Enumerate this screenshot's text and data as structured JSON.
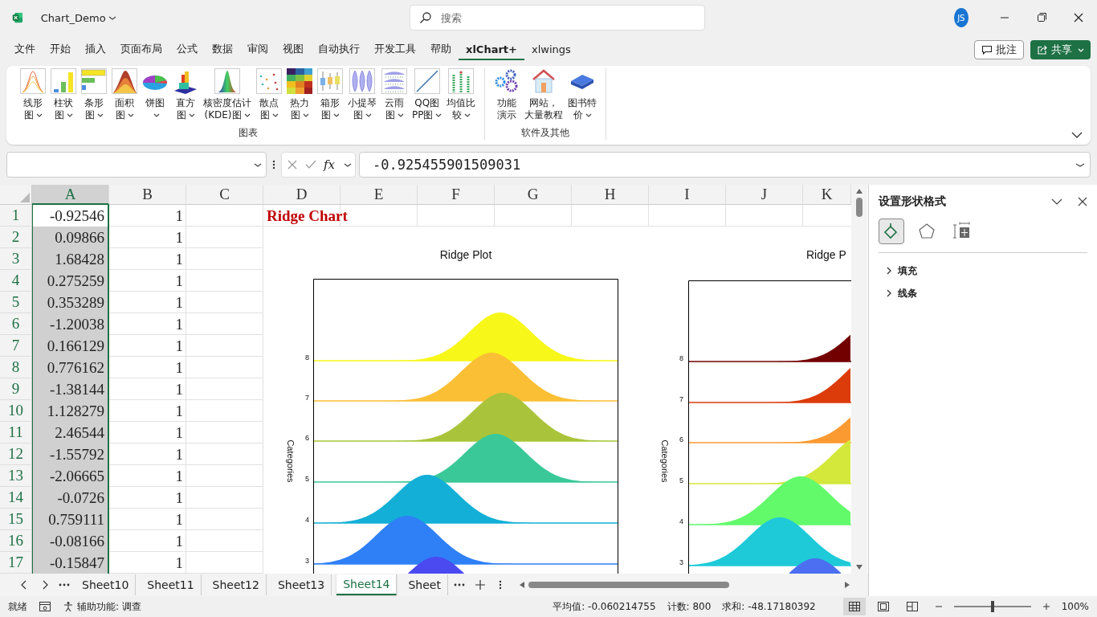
{
  "title_bar": {
    "file_name": "Chart_Demo",
    "search_placeholder": "搜索",
    "user_initials": "JS"
  },
  "menu_tabs": [
    {
      "label": "文件",
      "selected": false
    },
    {
      "label": "开始",
      "selected": false
    },
    {
      "label": "插入",
      "selected": false
    },
    {
      "label": "页面布局",
      "selected": false
    },
    {
      "label": "公式",
      "selected": false
    },
    {
      "label": "数据",
      "selected": false
    },
    {
      "label": "审阅",
      "selected": false
    },
    {
      "label": "视图",
      "selected": false
    },
    {
      "label": "自动执行",
      "selected": false
    },
    {
      "label": "开发工具",
      "selected": false
    },
    {
      "label": "帮助",
      "selected": false
    },
    {
      "label": "xlChart+",
      "selected": true
    },
    {
      "label": "xlwings",
      "selected": false
    }
  ],
  "header_buttons": {
    "comments": "批注",
    "share": "共享"
  },
  "ribbon": {
    "groups": [
      {
        "label": "图表",
        "items": [
          {
            "lines": [
              "线形",
              "图"
            ],
            "dropdown": true
          },
          {
            "lines": [
              "柱状",
              "图"
            ],
            "dropdown": true
          },
          {
            "lines": [
              "条形",
              "图"
            ],
            "dropdown": true
          },
          {
            "lines": [
              "面积",
              "图"
            ],
            "dropdown": true
          },
          {
            "lines": [
              "饼图"
            ],
            "dropdown": true
          },
          {
            "lines": [
              "直方",
              "图"
            ],
            "dropdown": true
          },
          {
            "lines": [
              "核密度估计",
              "(KDE)图"
            ],
            "dropdown": true
          },
          {
            "lines": [
              "散点",
              "图"
            ],
            "dropdown": true
          },
          {
            "lines": [
              "热力",
              "图"
            ],
            "dropdown": true
          },
          {
            "lines": [
              "箱形",
              "图"
            ],
            "dropdown": true
          },
          {
            "lines": [
              "小提琴",
              "图"
            ],
            "dropdown": true
          },
          {
            "lines": [
              "云雨",
              "图"
            ],
            "dropdown": true
          },
          {
            "lines": [
              "QQ图",
              "PP图"
            ],
            "dropdown": true
          },
          {
            "lines": [
              "均值比",
              "较"
            ],
            "dropdown": true
          }
        ]
      },
      {
        "label": "软件及其他",
        "items": [
          {
            "lines": [
              "功能",
              "演示"
            ],
            "dropdown": false
          },
          {
            "lines": [
              "网站，",
              "大量教程"
            ],
            "dropdown": false
          },
          {
            "lines": [
              "图书特",
              "价"
            ],
            "dropdown": true
          }
        ]
      }
    ]
  },
  "formula_bar": {
    "function_label": "fx",
    "value": "-0.925455901509031"
  },
  "sheet": {
    "columns": [
      {
        "label": "A",
        "selected": true
      },
      {
        "label": "B",
        "selected": false
      },
      {
        "label": "C",
        "selected": false
      },
      {
        "label": "D",
        "selected": false
      },
      {
        "label": "E",
        "selected": false
      },
      {
        "label": "F",
        "selected": false
      },
      {
        "label": "G",
        "selected": false
      },
      {
        "label": "H",
        "selected": false
      },
      {
        "label": "I",
        "selected": false
      },
      {
        "label": "J",
        "selected": false
      },
      {
        "label": "K",
        "selected": false
      }
    ],
    "rows": [
      {
        "header": "1",
        "a": "-0.92546",
        "b": "1",
        "d": "Ridge Chart",
        "active": true
      },
      {
        "header": "2",
        "a": "0.09866",
        "b": "1",
        "active": false
      },
      {
        "header": "3",
        "a": "1.68428",
        "b": "1",
        "active": false
      },
      {
        "header": "4",
        "a": "0.275259",
        "b": "1",
        "active": false
      },
      {
        "header": "5",
        "a": "0.353289",
        "b": "1",
        "active": false
      },
      {
        "header": "6",
        "a": "-1.20038",
        "b": "1",
        "active": false
      },
      {
        "header": "7",
        "a": "0.166129",
        "b": "1",
        "active": false
      },
      {
        "header": "8",
        "a": "0.776162",
        "b": "1",
        "active": false
      },
      {
        "header": "9",
        "a": "-1.38144",
        "b": "1",
        "active": false
      },
      {
        "header": "10",
        "a": "1.128279",
        "b": "1",
        "active": false
      },
      {
        "header": "11",
        "a": "2.46544",
        "b": "1",
        "active": false
      },
      {
        "header": "12",
        "a": "-1.55792",
        "b": "1",
        "active": false
      },
      {
        "header": "13",
        "a": "-2.06665",
        "b": "1",
        "active": false
      },
      {
        "header": "14",
        "a": "-0.0726",
        "b": "1",
        "active": false
      },
      {
        "header": "15",
        "a": "0.759111",
        "b": "1",
        "active": false
      },
      {
        "header": "16",
        "a": "-0.08166",
        "b": "1",
        "active": false
      },
      {
        "header": "17",
        "a": "-0.15847",
        "b": "1",
        "active": false
      }
    ],
    "charts": [
      {
        "title": "Ridge Plot",
        "ylabel": "Categories",
        "ridges": [
          {
            "label": "8",
            "color": "#f7f719"
          },
          {
            "label": "7",
            "color": "#fbbf35"
          },
          {
            "label": "6",
            "color": "#a9c43a"
          },
          {
            "label": "5",
            "color": "#3ac898"
          },
          {
            "label": "4",
            "color": "#13afd6"
          },
          {
            "label": "3",
            "color": "#2f80f7"
          },
          {
            "color": "#4a4af0"
          }
        ]
      },
      {
        "title": "Ridge P",
        "ylabel": "Categories",
        "ridges": [
          {
            "label": "8",
            "color": "#730000"
          },
          {
            "label": "7",
            "color": "#dc3b0a"
          },
          {
            "label": "6",
            "color": "#fb9a30"
          },
          {
            "label": "5",
            "color": "#d3e83a"
          },
          {
            "label": "4",
            "color": "#62fa6a"
          },
          {
            "label": "3",
            "color": "#1ecad8"
          },
          {
            "color": "#4b6ff0"
          }
        ]
      }
    ]
  },
  "sheet_tabs": [
    {
      "label": "Sheet10",
      "selected": false
    },
    {
      "label": "Sheet11",
      "selected": false
    },
    {
      "label": "Sheet12",
      "selected": false
    },
    {
      "label": "Sheet13",
      "selected": false
    },
    {
      "label": "Sheet14",
      "selected": true
    },
    {
      "label": "Sheet",
      "selected": false
    }
  ],
  "format_pane": {
    "title": "设置形状格式",
    "tabs": [
      {
        "selected": true
      },
      {
        "selected": false
      },
      {
        "selected": false
      }
    ],
    "sections": [
      {
        "label": "填充",
        "expanded": false
      },
      {
        "label": "线条",
        "expanded": false
      }
    ]
  },
  "status_bar": {
    "ready": "就绪",
    "accessibility": "辅助功能: 调查",
    "average": "平均值: -0.060214755",
    "count": "计数: 800",
    "sum": "求和: -48.17180392",
    "views": [
      {
        "selected": true
      },
      {
        "selected": false
      },
      {
        "selected": false
      }
    ],
    "zoom_level": {
      "level": 0.5
    },
    "zoom": "100%"
  }
}
